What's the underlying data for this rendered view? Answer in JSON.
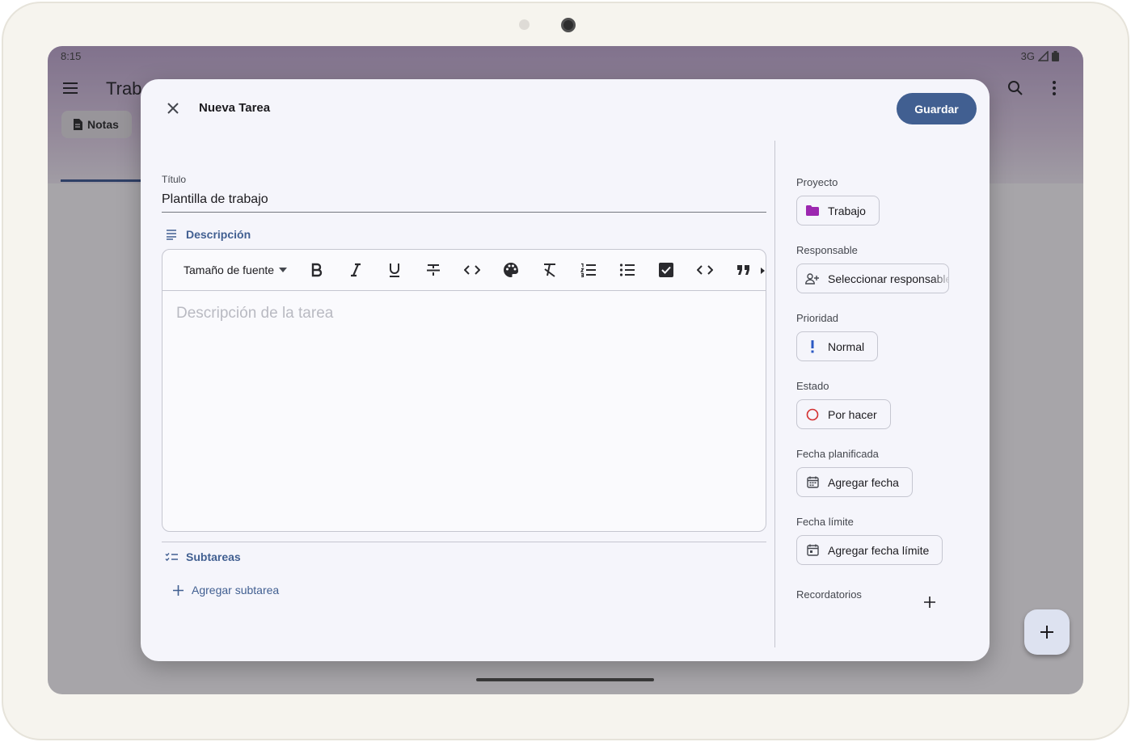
{
  "status": {
    "time": "8:15",
    "network": "3G"
  },
  "appbar": {
    "title": "Trab",
    "notes_chip": "Notas"
  },
  "dialog": {
    "title": "Nueva Tarea",
    "save_label": "Guardar",
    "title_field": {
      "label": "Título",
      "value": "Plantilla de trabajo"
    },
    "description": {
      "heading": "Descripción",
      "font_size_label": "Tamaño de fuente",
      "placeholder": "Descripción de la tarea"
    },
    "subtasks": {
      "heading": "Subtareas",
      "add_label": "Agregar subtarea"
    },
    "sidebar": {
      "project": {
        "label": "Proyecto",
        "value": "Trabajo",
        "color": "#9c27b0"
      },
      "assignee": {
        "label": "Responsable",
        "value": "Seleccionar responsable"
      },
      "priority": {
        "label": "Prioridad",
        "value": "Normal",
        "color": "#2b59c3"
      },
      "status": {
        "label": "Estado",
        "value": "Por hacer",
        "color": "#d32f2f"
      },
      "planned_date": {
        "label": "Fecha planificada",
        "value": "Agregar fecha"
      },
      "due_date": {
        "label": "Fecha límite",
        "value": "Agregar fecha límite"
      },
      "reminders": {
        "label": "Recordatorios"
      }
    }
  },
  "colors": {
    "accent": "#415f91",
    "surface": "#f5f5fb"
  }
}
